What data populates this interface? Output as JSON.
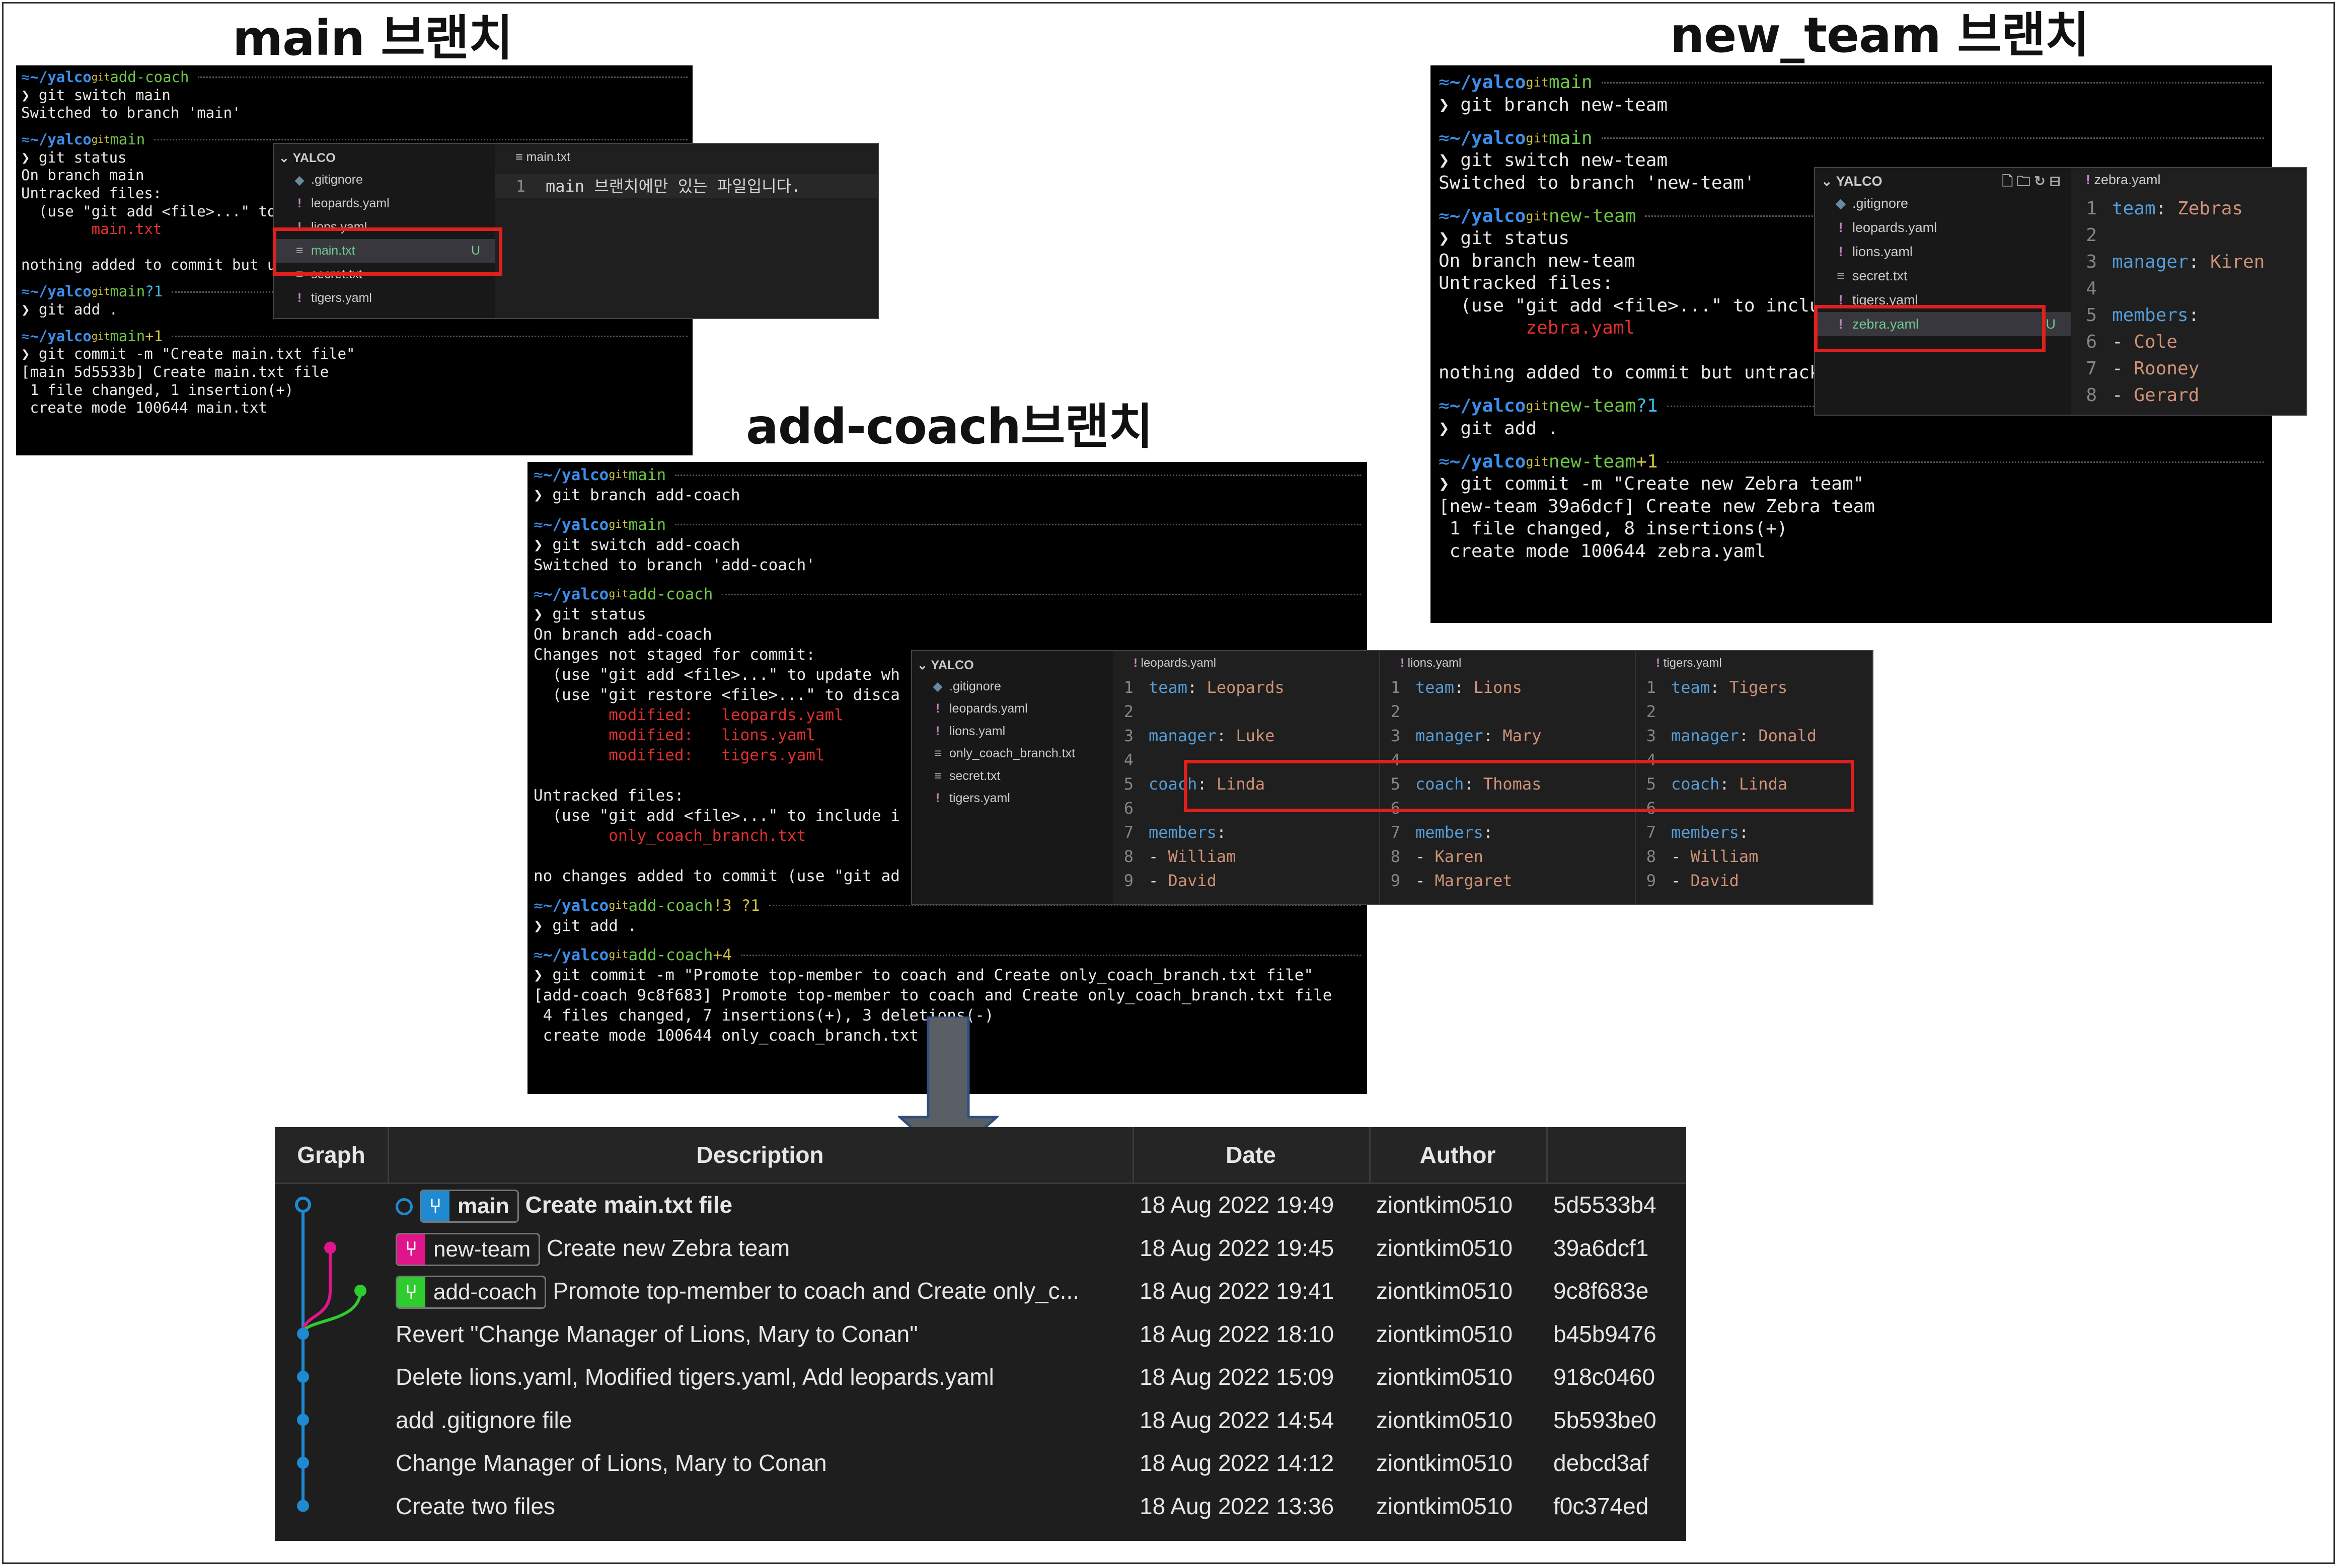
{
  "titles": {
    "main": "main 브랜치",
    "new_team": "new_team 브랜치",
    "add_coach": "add-coach브랜치"
  },
  "prompt": {
    "apple": "",
    "home": "≈",
    "dir": "~/yalco",
    "git_glyph": "git",
    "branch_glyph": "",
    "arrow": "❯"
  },
  "term_main": {
    "blocks": [
      {
        "branch": "add-coach",
        "status": "",
        "lines": [
          {
            "t": "❯ git switch main",
            "c": ""
          },
          {
            "t": "Switched to branch 'main'",
            "c": ""
          }
        ]
      },
      {
        "branch": "main",
        "status": "",
        "lines": [
          {
            "t": "❯ git status",
            "c": ""
          },
          {
            "t": "On branch main",
            "c": ""
          },
          {
            "t": "Untracked files:",
            "c": ""
          },
          {
            "t": "  (use \"git add <file>...\" to",
            "c": ""
          },
          {
            "t": "        main.txt",
            "c": "red"
          },
          {
            "t": "",
            "c": ""
          },
          {
            "t": "nothing added to commit but ur",
            "c": ""
          }
        ]
      },
      {
        "branch": "main",
        "status": "?1",
        "lines": [
          {
            "t": "❯ git add .",
            "c": ""
          }
        ]
      },
      {
        "branch": "main",
        "status": "+1",
        "lines": [
          {
            "t": "❯ git commit -m \"Create main.txt file\"",
            "c": ""
          },
          {
            "t": "[main 5d5533b] Create main.txt file",
            "c": ""
          },
          {
            "t": " 1 file changed, 1 insertion(+)",
            "c": ""
          },
          {
            "t": " create mode 100644 main.txt",
            "c": ""
          }
        ]
      }
    ]
  },
  "vsc_main": {
    "explorer_title": "YALCO",
    "files": [
      {
        "name": ".gitignore",
        "icon": "gitignore-icon",
        "glyph": "◆",
        "badge": ""
      },
      {
        "name": "leopards.yaml",
        "icon": "yaml-icon",
        "glyph": "!",
        "badge": ""
      },
      {
        "name": "lions.yaml",
        "icon": "yaml-icon",
        "glyph": "!",
        "badge": ""
      },
      {
        "name": "main.txt",
        "icon": "text-file-icon",
        "glyph": "≡",
        "badge": "U"
      },
      {
        "name": "secret.txt",
        "icon": "text-file-icon",
        "glyph": "≡",
        "badge": ""
      },
      {
        "name": "tigers.yaml",
        "icon": "yaml-icon",
        "glyph": "!",
        "badge": ""
      }
    ],
    "tab": "main.txt",
    "lines": [
      {
        "n": "1",
        "text": "main 브랜치에만 있는 파일입니다."
      }
    ]
  },
  "term_new": {
    "blocks": [
      {
        "branch": "main",
        "status": "",
        "lines": [
          {
            "t": "❯ git branch new-team",
            "c": ""
          }
        ]
      },
      {
        "branch": "main",
        "status": "",
        "lines": [
          {
            "t": "❯ git switch new-team",
            "c": ""
          },
          {
            "t": "Switched to branch 'new-team'",
            "c": ""
          }
        ]
      },
      {
        "branch": "new-team",
        "status": "",
        "lines": [
          {
            "t": "❯ git status",
            "c": ""
          },
          {
            "t": "On branch new-team",
            "c": ""
          },
          {
            "t": "Untracked files:",
            "c": ""
          },
          {
            "t": "  (use \"git add <file>...\" to inclu",
            "c": ""
          },
          {
            "t": "        zebra.yaml",
            "c": "red"
          },
          {
            "t": "",
            "c": ""
          },
          {
            "t": "nothing added to commit but untrack",
            "c": ""
          }
        ]
      },
      {
        "branch": "new-team",
        "status": "?1",
        "lines": [
          {
            "t": "❯ git add .",
            "c": ""
          }
        ]
      },
      {
        "branch": "new-team",
        "status": "+1",
        "lines": [
          {
            "t": "❯ git commit -m \"Create new Zebra team\"",
            "c": ""
          },
          {
            "t": "[new-team 39a6dcf] Create new Zebra team",
            "c": ""
          },
          {
            "t": " 1 file changed, 8 insertions(+)",
            "c": ""
          },
          {
            "t": " create mode 100644 zebra.yaml",
            "c": ""
          }
        ]
      }
    ]
  },
  "vsc_new": {
    "explorer_title": "YALCO",
    "files": [
      {
        "name": ".gitignore",
        "icon": "gitignore-icon",
        "glyph": "◆",
        "badge": ""
      },
      {
        "name": "leopards.yaml",
        "icon": "yaml-icon",
        "glyph": "!",
        "badge": ""
      },
      {
        "name": "lions.yaml",
        "icon": "yaml-icon",
        "glyph": "!",
        "badge": ""
      },
      {
        "name": "secret.txt",
        "icon": "text-file-icon",
        "glyph": "≡",
        "badge": ""
      },
      {
        "name": "tigers.yaml",
        "icon": "yaml-icon",
        "glyph": "!",
        "badge": ""
      },
      {
        "name": "zebra.yaml",
        "icon": "yaml-icon",
        "glyph": "!",
        "badge": "U"
      }
    ],
    "tab": "zebra.yaml",
    "lines": [
      {
        "n": "1",
        "k": "team",
        "v": "Zebras"
      },
      {
        "n": "2",
        "k": "",
        "v": ""
      },
      {
        "n": "3",
        "k": "manager",
        "v": "Kiren"
      },
      {
        "n": "4",
        "k": "",
        "v": ""
      },
      {
        "n": "5",
        "k": "members",
        "v": ""
      },
      {
        "n": "6",
        "k": "",
        "v": "Cole",
        "dash": true
      },
      {
        "n": "7",
        "k": "",
        "v": "Rooney",
        "dash": true
      },
      {
        "n": "8",
        "k": "",
        "v": "Gerard",
        "dash": true
      }
    ]
  },
  "term_add": {
    "blocks": [
      {
        "branch": "main",
        "status": "",
        "lines": [
          {
            "t": "❯ git branch add-coach",
            "c": ""
          }
        ]
      },
      {
        "branch": "main",
        "status": "",
        "lines": [
          {
            "t": "❯ git switch add-coach",
            "c": ""
          },
          {
            "t": "Switched to branch 'add-coach'",
            "c": ""
          }
        ]
      },
      {
        "branch": "add-coach",
        "status": "",
        "lines": [
          {
            "t": "❯ git status",
            "c": ""
          },
          {
            "t": "On branch add-coach",
            "c": ""
          },
          {
            "t": "Changes not staged for commit:",
            "c": ""
          },
          {
            "t": "  (use \"git add <file>...\" to update wh",
            "c": ""
          },
          {
            "t": "  (use \"git restore <file>...\" to disca",
            "c": ""
          },
          {
            "t": "        modified:   leopards.yaml",
            "c": "red"
          },
          {
            "t": "        modified:   lions.yaml",
            "c": "red"
          },
          {
            "t": "        modified:   tigers.yaml",
            "c": "red"
          },
          {
            "t": "",
            "c": ""
          },
          {
            "t": "Untracked files:",
            "c": ""
          },
          {
            "t": "  (use \"git add <file>...\" to include i",
            "c": ""
          },
          {
            "t": "        only_coach_branch.txt",
            "c": "red"
          },
          {
            "t": "",
            "c": ""
          },
          {
            "t": "no changes added to commit (use \"git ad",
            "c": ""
          }
        ]
      },
      {
        "branch": "add-coach",
        "status": "!3 ?1",
        "lines": [
          {
            "t": "❯ git add .",
            "c": ""
          }
        ]
      },
      {
        "branch": "add-coach",
        "status": "+4",
        "lines": [
          {
            "t": "❯ git commit -m \"Promote top-member to coach and Create only_coach_branch.txt file\"",
            "c": ""
          },
          {
            "t": "[add-coach 9c8f683] Promote top-member to coach and Create only_coach_branch.txt file",
            "c": ""
          },
          {
            "t": " 4 files changed, 7 insertions(+), 3 deletions(-)",
            "c": ""
          },
          {
            "t": " create mode 100644 only_coach_branch.txt",
            "c": ""
          }
        ]
      }
    ]
  },
  "vsc_add": {
    "explorer_title": "YALCO",
    "files": [
      {
        "name": ".gitignore",
        "icon": "gitignore-icon",
        "glyph": "◆"
      },
      {
        "name": "leopards.yaml",
        "icon": "yaml-icon",
        "glyph": "!"
      },
      {
        "name": "lions.yaml",
        "icon": "yaml-icon",
        "glyph": "!"
      },
      {
        "name": "only_coach_branch.txt",
        "icon": "text-file-icon",
        "glyph": "≡"
      },
      {
        "name": "secret.txt",
        "icon": "text-file-icon",
        "glyph": "≡"
      },
      {
        "name": "tigers.yaml",
        "icon": "yaml-icon",
        "glyph": "!"
      }
    ],
    "editors": [
      {
        "tab": "leopards.yaml",
        "lines": [
          {
            "n": "1",
            "k": "team",
            "v": "Leopards"
          },
          {
            "n": "2",
            "k": "",
            "v": ""
          },
          {
            "n": "3",
            "k": "manager",
            "v": "Luke"
          },
          {
            "n": "4",
            "k": "",
            "v": ""
          },
          {
            "n": "5",
            "k": "coach",
            "v": "Linda"
          },
          {
            "n": "6",
            "k": "",
            "v": ""
          },
          {
            "n": "7",
            "k": "members",
            "v": ""
          },
          {
            "n": "8",
            "k": "",
            "v": "William",
            "dash": true
          },
          {
            "n": "9",
            "k": "",
            "v": "David",
            "dash": true
          }
        ]
      },
      {
        "tab": "lions.yaml",
        "lines": [
          {
            "n": "1",
            "k": "team",
            "v": "Lions"
          },
          {
            "n": "2",
            "k": "",
            "v": ""
          },
          {
            "n": "3",
            "k": "manager",
            "v": "Mary"
          },
          {
            "n": "4",
            "k": "",
            "v": ""
          },
          {
            "n": "5",
            "k": "coach",
            "v": "Thomas"
          },
          {
            "n": "6",
            "k": "",
            "v": ""
          },
          {
            "n": "7",
            "k": "members",
            "v": ""
          },
          {
            "n": "8",
            "k": "",
            "v": "Karen",
            "dash": true
          },
          {
            "n": "9",
            "k": "",
            "v": "Margaret",
            "dash": true
          }
        ]
      },
      {
        "tab": "tigers.yaml",
        "lines": [
          {
            "n": "1",
            "k": "team",
            "v": "Tigers"
          },
          {
            "n": "2",
            "k": "",
            "v": ""
          },
          {
            "n": "3",
            "k": "manager",
            "v": "Donald"
          },
          {
            "n": "4",
            "k": "",
            "v": ""
          },
          {
            "n": "5",
            "k": "coach",
            "v": "Linda"
          },
          {
            "n": "6",
            "k": "",
            "v": ""
          },
          {
            "n": "7",
            "k": "members",
            "v": ""
          },
          {
            "n": "8",
            "k": "",
            "v": "William",
            "dash": true
          },
          {
            "n": "9",
            "k": "",
            "v": "David",
            "dash": true
          }
        ]
      }
    ]
  },
  "git_graph": {
    "headers": [
      "Graph",
      "Description",
      "Date",
      "Author"
    ],
    "rows": [
      {
        "ref": "main",
        "ref_color": "#1f8ad2",
        "desc": "Create main.txt file",
        "bold": true,
        "date": "18 Aug 2022 19:49",
        "author": "ziontkim0510",
        "hash": "5d5533b4"
      },
      {
        "ref": "new-team",
        "ref_color": "#e0158a",
        "desc": "Create new Zebra team",
        "date": "18 Aug 2022 19:45",
        "author": "ziontkim0510",
        "hash": "39a6dcf1"
      },
      {
        "ref": "add-coach",
        "ref_color": "#2ecc2e",
        "desc": "Promote top-member to coach and Create only_c...",
        "date": "18 Aug 2022 19:41",
        "author": "ziontkim0510",
        "hash": "9c8f683e"
      },
      {
        "ref": "",
        "desc": "Revert \"Change Manager of Lions, Mary to Conan\"",
        "date": "18 Aug 2022 18:10",
        "author": "ziontkim0510",
        "hash": "b45b9476"
      },
      {
        "ref": "",
        "desc": "Delete lions.yaml, Modified tigers.yaml, Add leopards.yaml",
        "date": "18 Aug 2022 15:09",
        "author": "ziontkim0510",
        "hash": "918c0460"
      },
      {
        "ref": "",
        "desc": "add .gitignore file",
        "date": "18 Aug 2022 14:54",
        "author": "ziontkim0510",
        "hash": "5b593be0"
      },
      {
        "ref": "",
        "desc": "Change Manager of Lions, Mary to Conan",
        "date": "18 Aug 2022 14:12",
        "author": "ziontkim0510",
        "hash": "debcd3af"
      },
      {
        "ref": "",
        "desc": "Create two files",
        "date": "18 Aug 2022 13:36",
        "author": "ziontkim0510",
        "hash": "f0c374ed"
      }
    ],
    "colors": {
      "main": "#1f8ad2",
      "new_team": "#e0158a",
      "add_coach": "#2ecc2e"
    }
  }
}
